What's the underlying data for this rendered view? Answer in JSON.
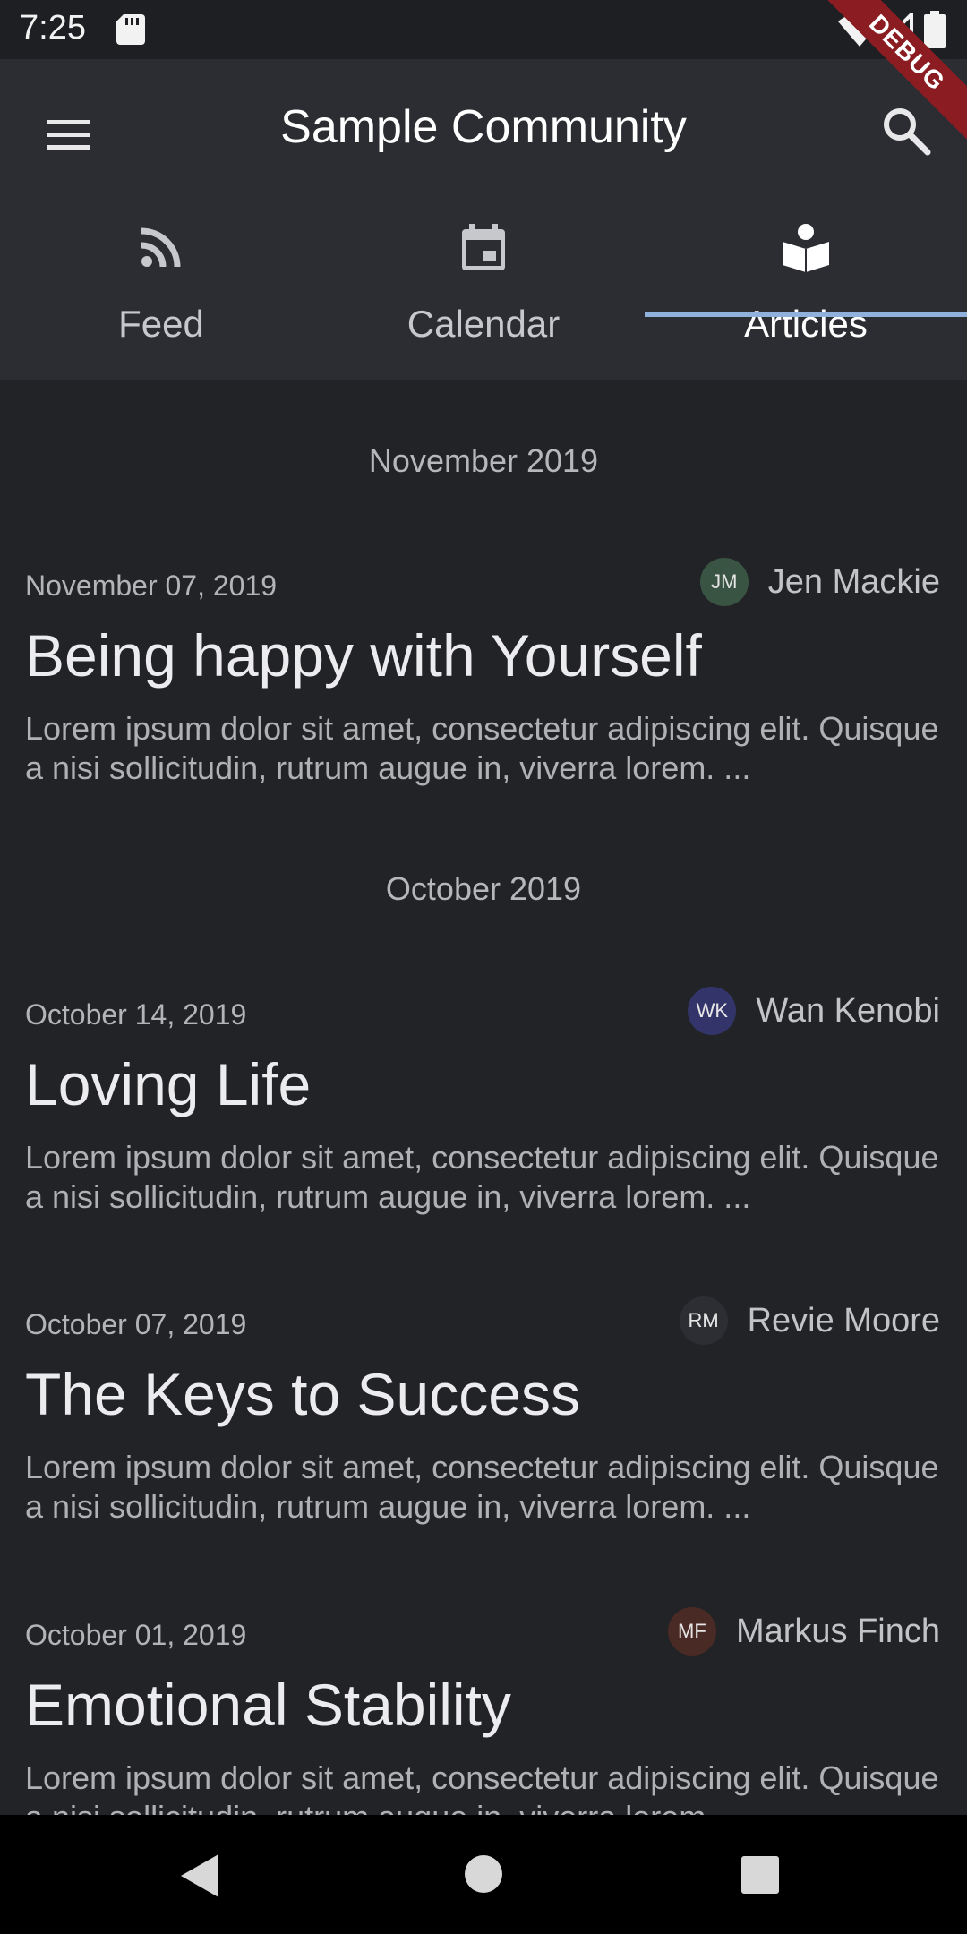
{
  "status_bar": {
    "time": "7:25",
    "icons": [
      "sd-card-icon",
      "wifi-icon",
      "signal-icon",
      "battery-icon"
    ]
  },
  "debug_banner": "DEBUG",
  "app_bar": {
    "title": "Sample Community",
    "menu_icon": "menu-icon",
    "search_icon": "search-icon"
  },
  "tabs": [
    {
      "label": "Feed",
      "icon": "rss-icon",
      "active": false
    },
    {
      "label": "Calendar",
      "icon": "calendar-icon",
      "active": false
    },
    {
      "label": "Articles",
      "icon": "book-reader-icon",
      "active": true
    }
  ],
  "sections": [
    {
      "month": "November 2019",
      "articles": [
        {
          "date": "November 07, 2019",
          "author_initials": "JM",
          "author_name": "Jen Mackie",
          "avatar_color": "#3a5443",
          "title": "Being happy with Yourself",
          "excerpt": "Lorem ipsum dolor sit amet, consectetur adipiscing elit. Quisque a nisi sollicitudin, rutrum augue in, viverra lorem. ..."
        }
      ]
    },
    {
      "month": "October 2019",
      "articles": [
        {
          "date": "October 14, 2019",
          "author_initials": "WK",
          "author_name": "Wan Kenobi",
          "avatar_color": "#33356a",
          "title": "Loving Life",
          "excerpt": "Lorem ipsum dolor sit amet, consectetur adipiscing elit. Quisque a nisi sollicitudin, rutrum augue in, viverra lorem. ..."
        },
        {
          "date": "October 07, 2019",
          "author_initials": "RM",
          "author_name": "Revie Moore",
          "avatar_color": "#2d2e33",
          "title": "The Keys to Success",
          "excerpt": "Lorem ipsum dolor sit amet, consectetur adipiscing elit. Quisque a nisi sollicitudin, rutrum augue in, viverra lorem. ..."
        },
        {
          "date": "October 01, 2019",
          "author_initials": "MF",
          "author_name": "Markus Finch",
          "avatar_color": "#4a2a24",
          "title": "Emotional Stability",
          "excerpt": "Lorem ipsum dolor sit amet, consectetur adipiscing elit. Quisque a nisi sollicitudin, rutrum augue in, viverra lorem. ..."
        }
      ]
    }
  ],
  "colors": {
    "background": "#222327",
    "app_bar": "#2c2d32",
    "tab_indicator": "#8fb1dc",
    "debug_ribbon": "#8a1c22"
  },
  "nav_bar": {
    "icons": [
      "back-icon",
      "home-icon",
      "recent-apps-icon"
    ]
  }
}
